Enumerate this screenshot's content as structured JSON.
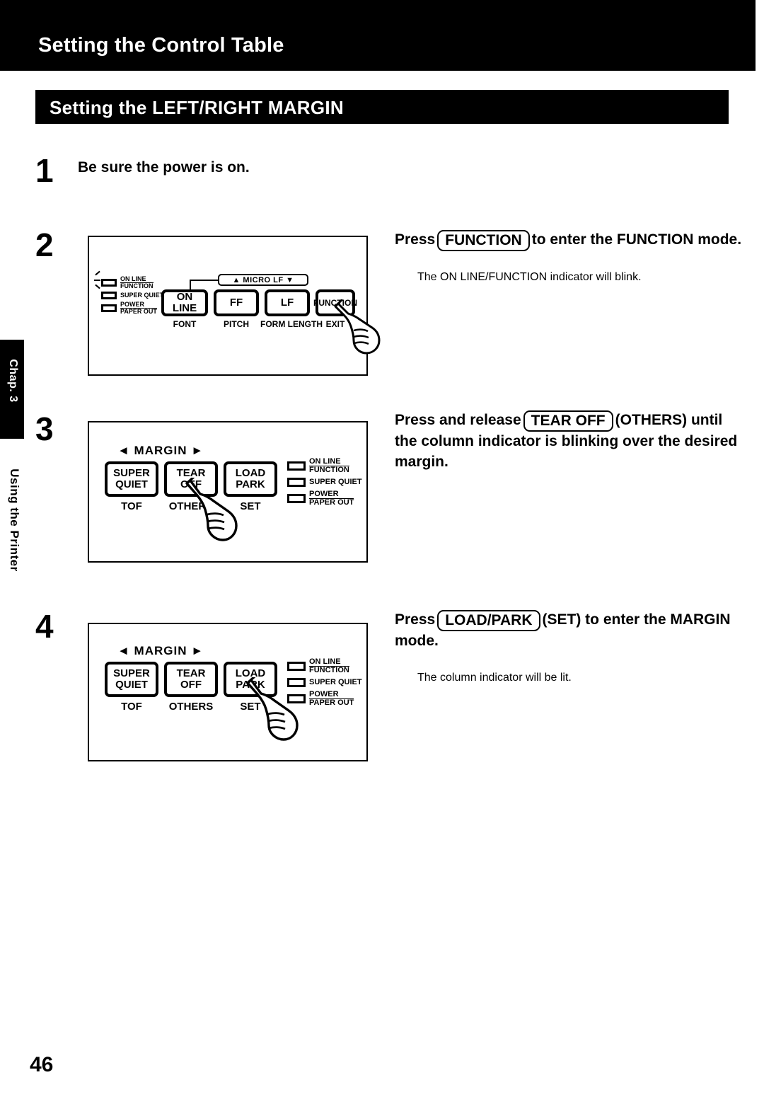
{
  "header": {
    "title": "Setting the Control Table",
    "subtitle": "Setting the LEFT/RIGHT MARGIN"
  },
  "side_tab": {
    "chapter": "Chap. 3",
    "label": "Using the Printer"
  },
  "page_number": "46",
  "steps": [
    {
      "number": "1",
      "text": "Be sure the power is on."
    },
    {
      "number": "2",
      "instruction_pre": "Press",
      "key": "FUNCTION",
      "instruction_post": "to enter the FUNCTION mode.",
      "note": "The ON LINE/FUNCTION indicator will blink."
    },
    {
      "number": "3",
      "instruction_pre": "Press and release",
      "key": "TEAR OFF",
      "instruction_post": "(OTHERS) until the column indicator is blinking over the desired margin.",
      "note": ""
    },
    {
      "number": "4",
      "instruction_pre": "Press",
      "key": "LOAD/PARK",
      "instruction_post": "(SET) to enter the MARGIN mode.",
      "note": "The column indicator will be lit."
    }
  ],
  "panel_top": {
    "leds": [
      {
        "line1": "ON LINE",
        "line2": "FUNCTION",
        "blinking": true
      },
      {
        "line1": "SUPER QUIET",
        "line2": "",
        "blinking": false
      },
      {
        "line1": "POWER",
        "line2": "PAPER OUT",
        "blinking": false
      }
    ],
    "microlf": "▲  MICRO LF   ▼",
    "keys": [
      {
        "label": "ON LINE",
        "sublabel": "FONT"
      },
      {
        "label": "FF",
        "sublabel": "PITCH"
      },
      {
        "label": "LF",
        "sublabel": "FORM LENGTH"
      },
      {
        "label": "FUNCTION",
        "sublabel": "EXIT"
      }
    ],
    "pressed_key": "FUNCTION"
  },
  "panel_margin_3": {
    "margin_label": "◄ MARGIN ►",
    "keys": [
      {
        "line1": "SUPER",
        "line2": "QUIET",
        "sublabel": "TOF"
      },
      {
        "line1": "TEAR",
        "line2": "OFF",
        "sublabel": "OTHERS"
      },
      {
        "line1": "LOAD",
        "line2": "PARK",
        "sublabel": "SET"
      }
    ],
    "leds": [
      {
        "line1": "ON LINE",
        "line2": "FUNCTION"
      },
      {
        "line1": "SUPER QUIET",
        "line2": ""
      },
      {
        "line1": "POWER",
        "line2": "PAPER OUT"
      }
    ],
    "pressed_key": "TEAR OFF"
  },
  "panel_margin_4": {
    "margin_label": "◄ MARGIN ►",
    "keys": [
      {
        "line1": "SUPER",
        "line2": "QUIET",
        "sublabel": "TOF"
      },
      {
        "line1": "TEAR",
        "line2": "OFF",
        "sublabel": "OTHERS"
      },
      {
        "line1": "LOAD",
        "line2": "PARK",
        "sublabel": "SET"
      }
    ],
    "leds": [
      {
        "line1": "ON LINE",
        "line2": "FUNCTION"
      },
      {
        "line1": "SUPER QUIET",
        "line2": ""
      },
      {
        "line1": "POWER",
        "line2": "PAPER OUT"
      }
    ],
    "pressed_key": "LOAD/PARK"
  }
}
